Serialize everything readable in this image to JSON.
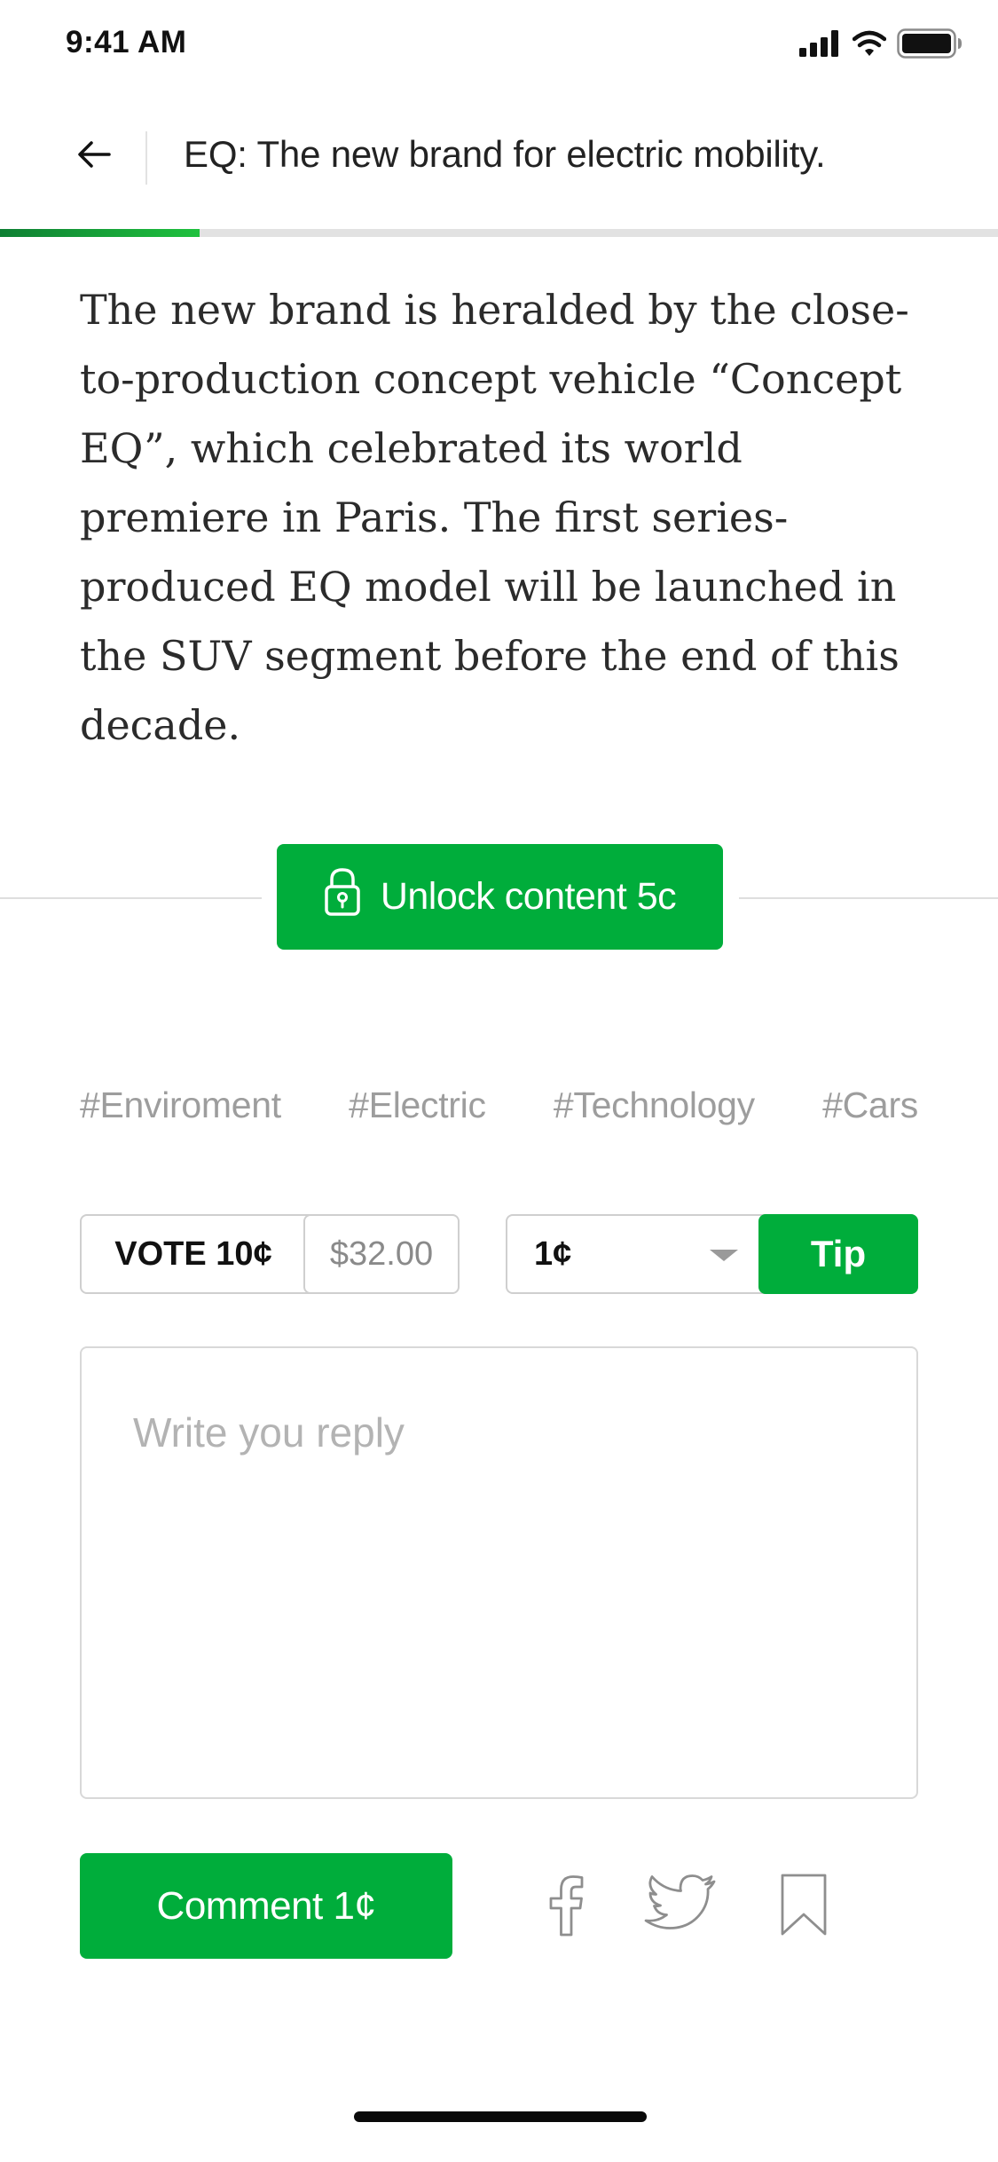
{
  "status_bar": {
    "time": "9:41 AM",
    "icons": [
      "cellular-signal-icon",
      "wifi-icon",
      "battery-icon"
    ]
  },
  "header": {
    "back_icon": "arrow-left-icon",
    "title": "EQ: The new brand for electric mobility."
  },
  "reading_progress": 0.2,
  "article": {
    "body": "The new brand is heralded by the close-to-production concept vehicle “Concept EQ”, which celebrated its world premiere in Paris. The first series-produced EQ model will be launched in the SUV segment before the end of this decade."
  },
  "unlock": {
    "icon": "lock-icon",
    "label": "Unlock content 5c"
  },
  "tags": [
    "#Enviroment",
    "#Electric",
    "#Technology",
    "#Cars"
  ],
  "vote": {
    "label": "VOTE 10¢",
    "amount": "$32.00"
  },
  "tip": {
    "selected_value": "1¢",
    "button_label": "Tip"
  },
  "reply": {
    "placeholder": "Write you reply",
    "value": ""
  },
  "comment": {
    "button_label": "Comment 1¢"
  },
  "share_icons": [
    "facebook-icon",
    "twitter-icon",
    "bookmark-icon"
  ],
  "colors": {
    "accent": "#00ad3b",
    "progress_dark": "#0e7f33",
    "tag_gray": "#9d9d9d",
    "border_gray": "#cfcfcf"
  }
}
